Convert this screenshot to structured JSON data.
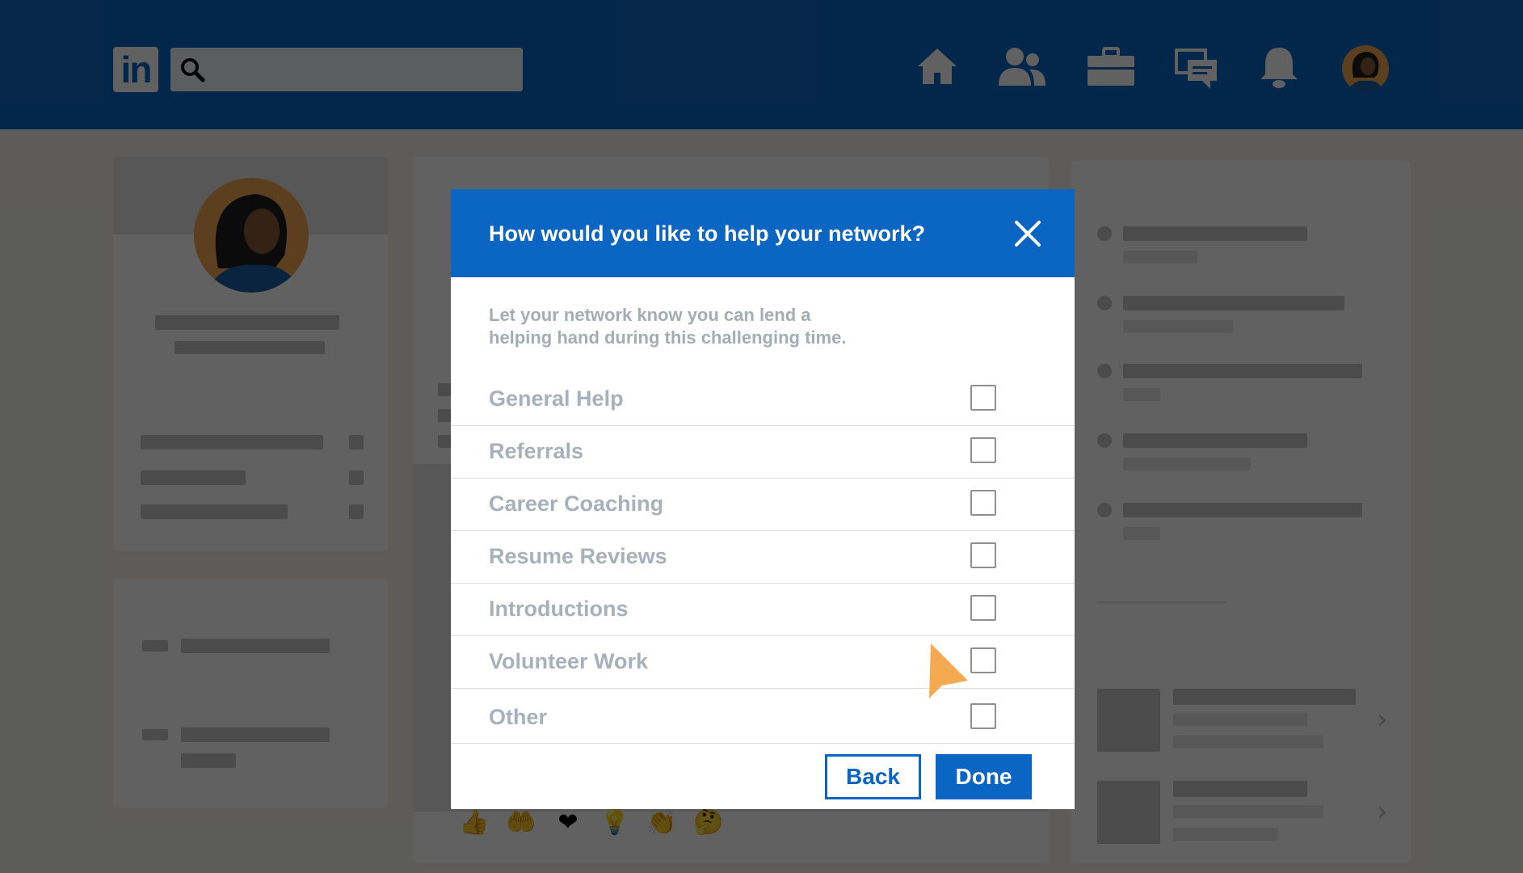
{
  "colors": {
    "brand": "#0a66c2",
    "overlay": "rgba(0,0,0,0.62)",
    "option_text": "#a8b0ba",
    "pointer": "#f5a951"
  },
  "nav": {
    "logo_text": "in",
    "icons": [
      "home-icon",
      "my-network-icon",
      "jobs-icon",
      "messaging-icon",
      "notifications-icon",
      "profile-avatar"
    ]
  },
  "modal": {
    "title": "How would you like to help your network?",
    "description": "Let your network know you can lend a helping hand during this challenging time.",
    "options": [
      {
        "label": "General Help",
        "checked": false
      },
      {
        "label": "Referrals",
        "checked": false
      },
      {
        "label": "Career Coaching",
        "checked": false
      },
      {
        "label": "Resume Reviews",
        "checked": false
      },
      {
        "label": "Introductions",
        "checked": false
      },
      {
        "label": "Volunteer Work",
        "checked": false
      },
      {
        "label": "Other",
        "checked": false
      }
    ],
    "back_label": "Back",
    "done_label": "Done"
  },
  "reactions": [
    "👍",
    "🤲",
    "❤",
    "💡",
    "👏",
    "🤔"
  ]
}
